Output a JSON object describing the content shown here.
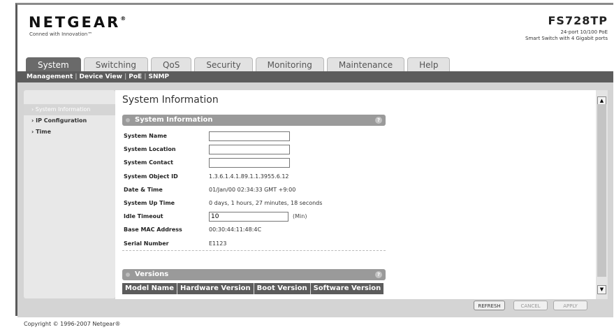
{
  "header": {
    "logo": "NETGEAR",
    "logo_mark": "®",
    "tagline": "Conned with Innovation™",
    "model": "FS728TP",
    "model_desc_line1": "24-port 10/100 PoE",
    "model_desc_line2": "Smart Switch with 4 Gigabit ports"
  },
  "tabs": [
    "System",
    "Switching",
    "QoS",
    "Security",
    "Monitoring",
    "Maintenance",
    "Help"
  ],
  "subnav": [
    "Management",
    "Device View",
    "PoE",
    "SNMP"
  ],
  "left_nav": [
    "System Information",
    "IP Configuration",
    "Time"
  ],
  "main": {
    "title": "System Information",
    "section_title": "System Information",
    "help_glyph": "?",
    "labels": {
      "name": "System Name",
      "location": "System Location",
      "contact": "System Contact",
      "object_id": "System Object ID",
      "date_time": "Date & Time",
      "uptime": "System Up Time",
      "idle_timeout": "Idle Timeout",
      "mac": "Base MAC Address",
      "serial": "Serial Number"
    },
    "values": {
      "name": "",
      "location": "",
      "contact": "",
      "object_id": "1.3.6.1.4.1.89.1.1.3955.6.12",
      "date_time": "01/Jan/00  02:34:33 GMT +9:00",
      "uptime": "0 days, 1 hours, 27 minutes, 18 seconds",
      "idle_timeout": "10",
      "idle_unit": "(Min)",
      "mac": "00:30:44:11:48:4C",
      "serial": "E1123"
    },
    "versions_title": "Versions",
    "versions_columns": [
      "Model Name",
      "Hardware Version",
      "Boot Version",
      "Software Version"
    ]
  },
  "buttons": {
    "refresh": "REFRESH",
    "cancel": "CANCEL",
    "apply": "APPLY"
  },
  "scroll": {
    "up": "▲",
    "down": "▼"
  },
  "footer": "Copyright © 1996-2007 Netgear®"
}
